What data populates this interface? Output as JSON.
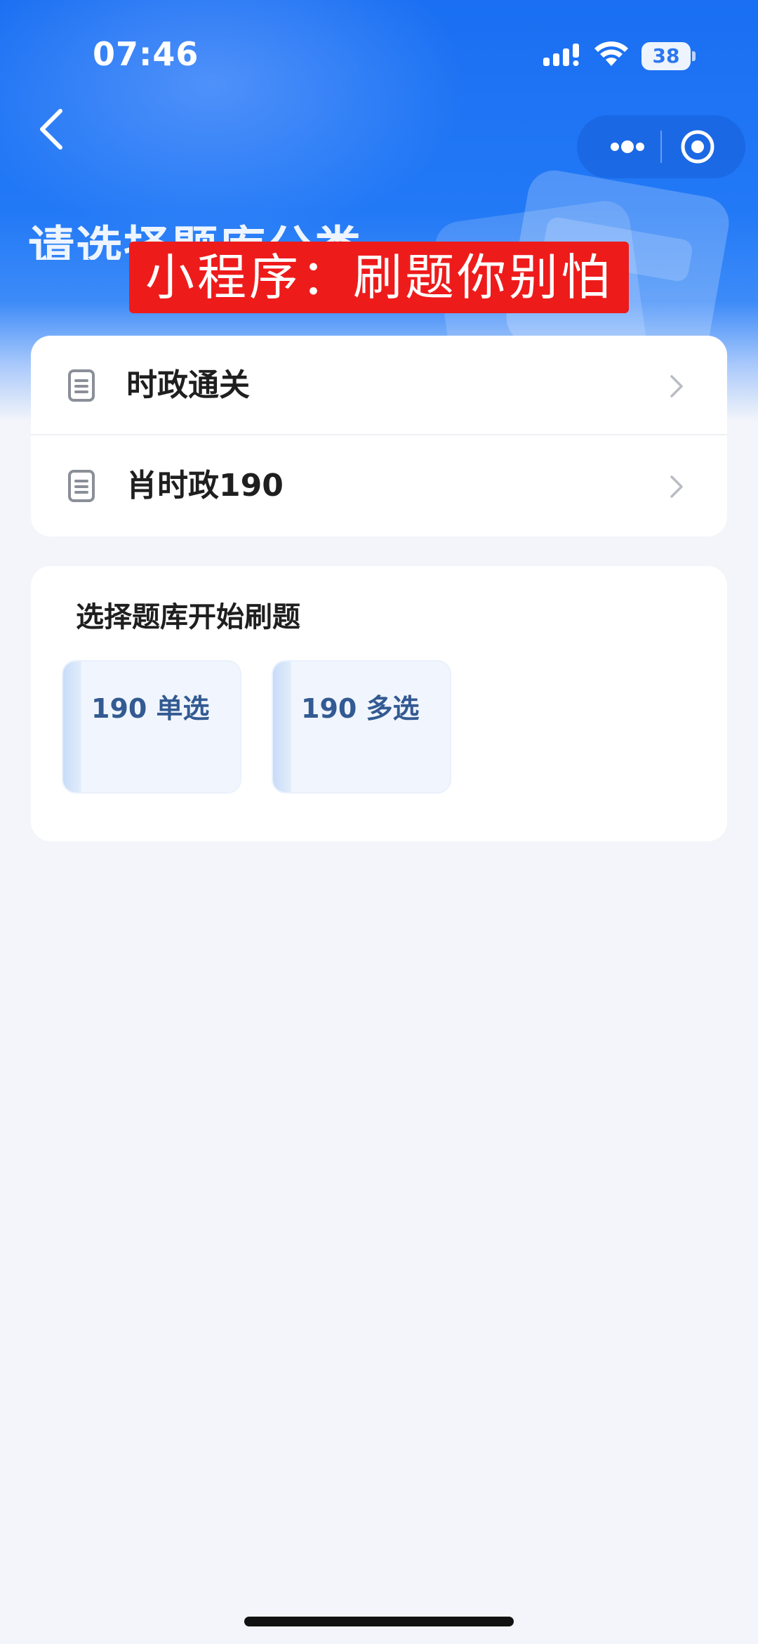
{
  "status_bar": {
    "time": "07:46",
    "battery": "38",
    "icons": [
      "cellular-signal-icon",
      "wifi-icon",
      "battery-icon"
    ]
  },
  "nav": {
    "back_icon": "chevron-left-icon",
    "capsule_icons": [
      "more-dots-icon",
      "close-circle-icon"
    ]
  },
  "header": {
    "title": "请选择题库分类",
    "overlay_banner": "小程序：刷题你别怕"
  },
  "categories": {
    "items": [
      {
        "label": "时政通关",
        "icon": "document-icon"
      },
      {
        "label": "肖时政190",
        "icon": "document-icon"
      }
    ]
  },
  "question_bank": {
    "title": "选择题库开始刷题",
    "tiles": [
      {
        "label": "190 单选"
      },
      {
        "label": "190 多选"
      }
    ]
  },
  "colors": {
    "header_blue": "#1a6ff2",
    "banner_red": "#ee1b1b",
    "tile_text": "#335a92",
    "background": "#f3f5fa"
  }
}
